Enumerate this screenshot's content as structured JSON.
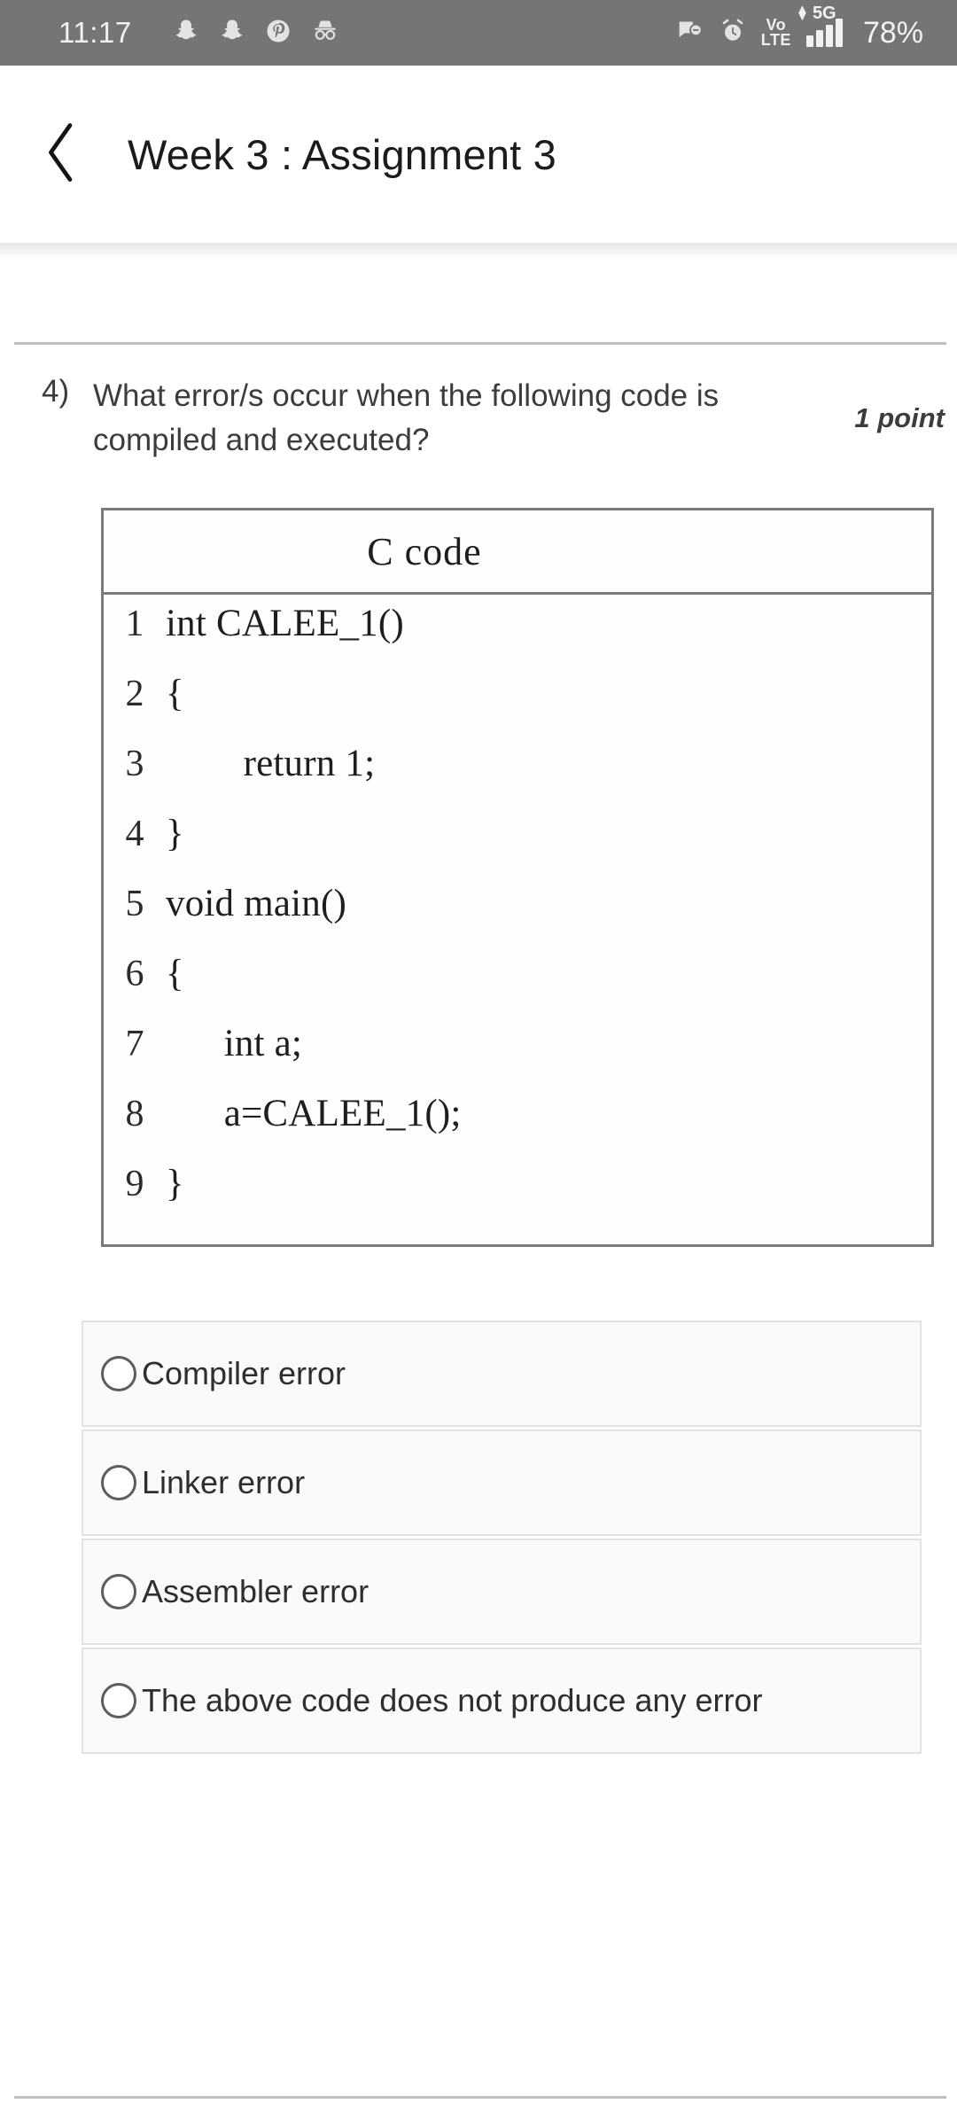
{
  "status_bar": {
    "time": "11:17",
    "battery": "78%",
    "network_label": "5G",
    "volte_top": "Vo",
    "volte_bottom": "LTE",
    "left_icons": [
      "snapchat-icon",
      "snapchat-icon",
      "pinterest-icon",
      "incognito-icon"
    ],
    "right_icons": [
      "chat-muted-icon",
      "alarm-icon",
      "volte-icon",
      "signal-5g-icon"
    ],
    "background_color": "#757575"
  },
  "app_bar": {
    "back_icon": "chevron-left-icon",
    "title": "Week 3 : Assignment 3"
  },
  "question": {
    "number": "4)",
    "text": "What error/s occur when the following code is compiled and executed?",
    "points": "1 point"
  },
  "code_block": {
    "header": "C code",
    "lines": [
      {
        "n": "1",
        "src": "int CALEE_1()"
      },
      {
        "n": "2",
        "src": "{"
      },
      {
        "n": "3",
        "src": "        return 1;"
      },
      {
        "n": "4",
        "src": "}"
      },
      {
        "n": "5",
        "src": "void main()"
      },
      {
        "n": "6",
        "src": "{"
      },
      {
        "n": "7",
        "src": "      int a;"
      },
      {
        "n": "8",
        "src": "      a=CALEE_1();"
      },
      {
        "n": "9",
        "src": "}"
      }
    ]
  },
  "options": [
    {
      "label": "Compiler error",
      "selected": false
    },
    {
      "label": "Linker error",
      "selected": false
    },
    {
      "label": "Assembler error",
      "selected": false
    },
    {
      "label": "The above code does not produce any error",
      "selected": false
    }
  ]
}
